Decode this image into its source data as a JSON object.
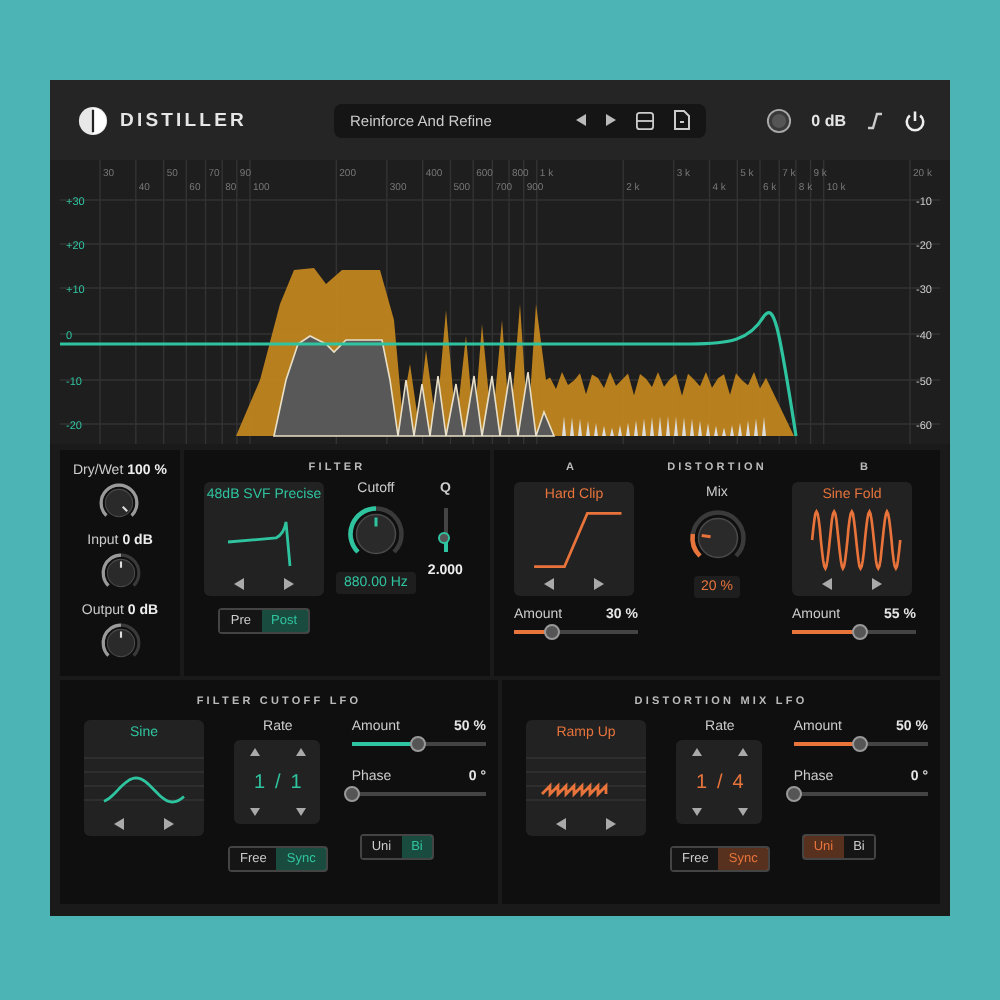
{
  "header": {
    "logo": "DISTILLER",
    "preset": "Reinforce And Refine",
    "output_gain": "0 dB",
    "power_on": true
  },
  "spectrum": {
    "frequency_labels": [
      "30",
      "40",
      "50",
      "60",
      "70",
      "80",
      "90",
      "100",
      "200",
      "300",
      "400",
      "500",
      "600",
      "700",
      "800",
      "900",
      "1 k",
      "2 k",
      "3 k",
      "4 k",
      "5 k",
      "6 k",
      "7 k",
      "8 k",
      "9 k",
      "10 k",
      "20 k"
    ],
    "gain_labels": [
      "+30",
      "+20",
      "+10",
      "0",
      "-10",
      "-20"
    ],
    "level_labels": [
      "-10",
      "-20",
      "-30",
      "-40",
      "-50",
      "-60"
    ]
  },
  "io": [
    {
      "label": "Dry/Wet",
      "value": "100 %",
      "level": 1.0
    },
    {
      "label": "Input",
      "value": "0 dB",
      "level": 0.5
    },
    {
      "label": "Output",
      "value": "0 dB",
      "level": 0.5
    }
  ],
  "filter": {
    "title": "FILTER",
    "type": "48dB SVF Precise",
    "cutoff": {
      "label": "Cutoff",
      "value": "880.00 Hz",
      "level": 0.5
    },
    "q": {
      "label": "Q",
      "value": "2.000",
      "level": 0.35
    },
    "routing": [
      {
        "label": "Pre",
        "selected": false
      },
      {
        "label": "Post",
        "selected": true
      }
    ]
  },
  "distortion": {
    "title": "DISTORTION",
    "mix": {
      "label": "Mix",
      "value": "20 %",
      "level": 0.2
    },
    "slots": [
      {
        "heading": "A",
        "shape": "Hard Clip",
        "kind": "clip",
        "amount": {
          "label": "Amount",
          "value": "30 %",
          "level": 0.3
        }
      },
      {
        "heading": "B",
        "shape": "Sine Fold",
        "kind": "fold",
        "amount": {
          "label": "Amount",
          "value": "55 %",
          "level": 0.55
        }
      }
    ]
  },
  "lfos": [
    {
      "title": "FILTER CUTOFF LFO",
      "color": "#2fc4a0",
      "waveform": "Sine",
      "kind": "sine",
      "rate_label": "Rate",
      "rate": {
        "numerator": "1",
        "separator": "/",
        "denominator": "1"
      },
      "amount": {
        "label": "Amount",
        "value": "50 %",
        "level": 0.5
      },
      "phase": {
        "label": "Phase",
        "value": "0 °",
        "level": 0
      },
      "sync": [
        {
          "label": "Free",
          "selected": false
        },
        {
          "label": "Sync",
          "selected": true
        }
      ],
      "polarity": [
        {
          "label": "Uni",
          "selected": false
        },
        {
          "label": "Bi",
          "selected": true
        }
      ]
    },
    {
      "title": "DISTORTION MIX LFO",
      "color": "#e8743b",
      "waveform": "Ramp Up",
      "kind": "ramp",
      "rate_label": "Rate",
      "rate": {
        "numerator": "1",
        "separator": "/",
        "denominator": "4"
      },
      "amount": {
        "label": "Amount",
        "value": "50 %",
        "level": 0.5
      },
      "phase": {
        "label": "Phase",
        "value": "0 °",
        "level": 0
      },
      "sync": [
        {
          "label": "Free",
          "selected": false
        },
        {
          "label": "Sync",
          "selected": true
        }
      ],
      "polarity": [
        {
          "label": "Uni",
          "selected": true
        },
        {
          "label": "Bi",
          "selected": false
        }
      ]
    }
  ]
}
